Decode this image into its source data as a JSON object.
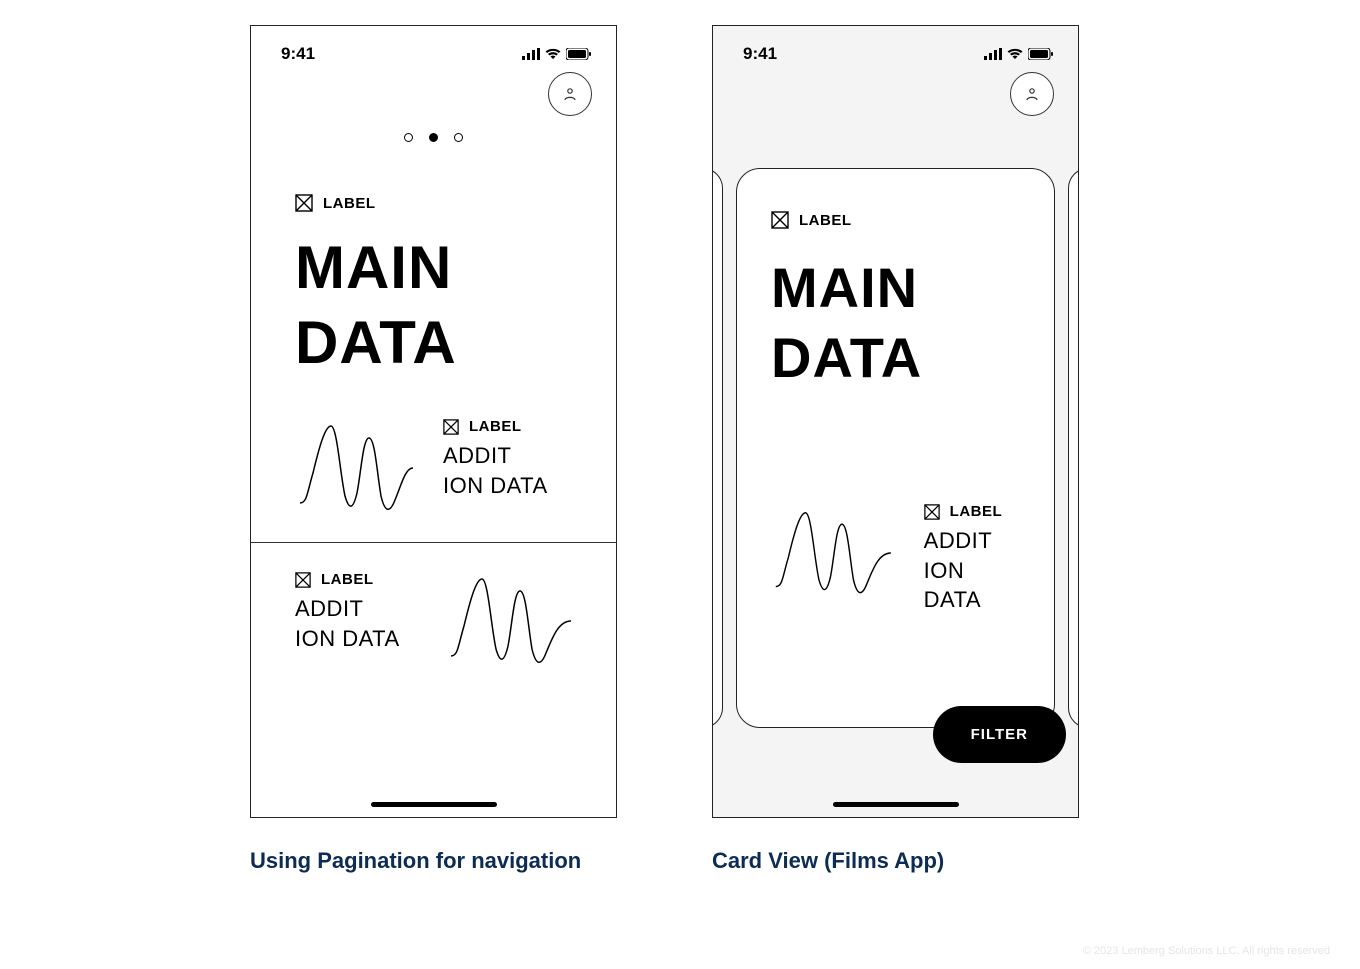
{
  "status": {
    "time": "9:41"
  },
  "labels": {
    "generic": "LABEL"
  },
  "main": {
    "title_line1": "MAIN",
    "title_line2": "DATA"
  },
  "additional": {
    "line1": "ADDIT",
    "line2": "ION DATA"
  },
  "filter": {
    "label": "FILTER"
  },
  "captions": {
    "left": "Using Pagination for navigation",
    "right": "Card View (Films App)"
  },
  "footer": "© 2023 Lemberg Solutions LLC. All rights reserved"
}
